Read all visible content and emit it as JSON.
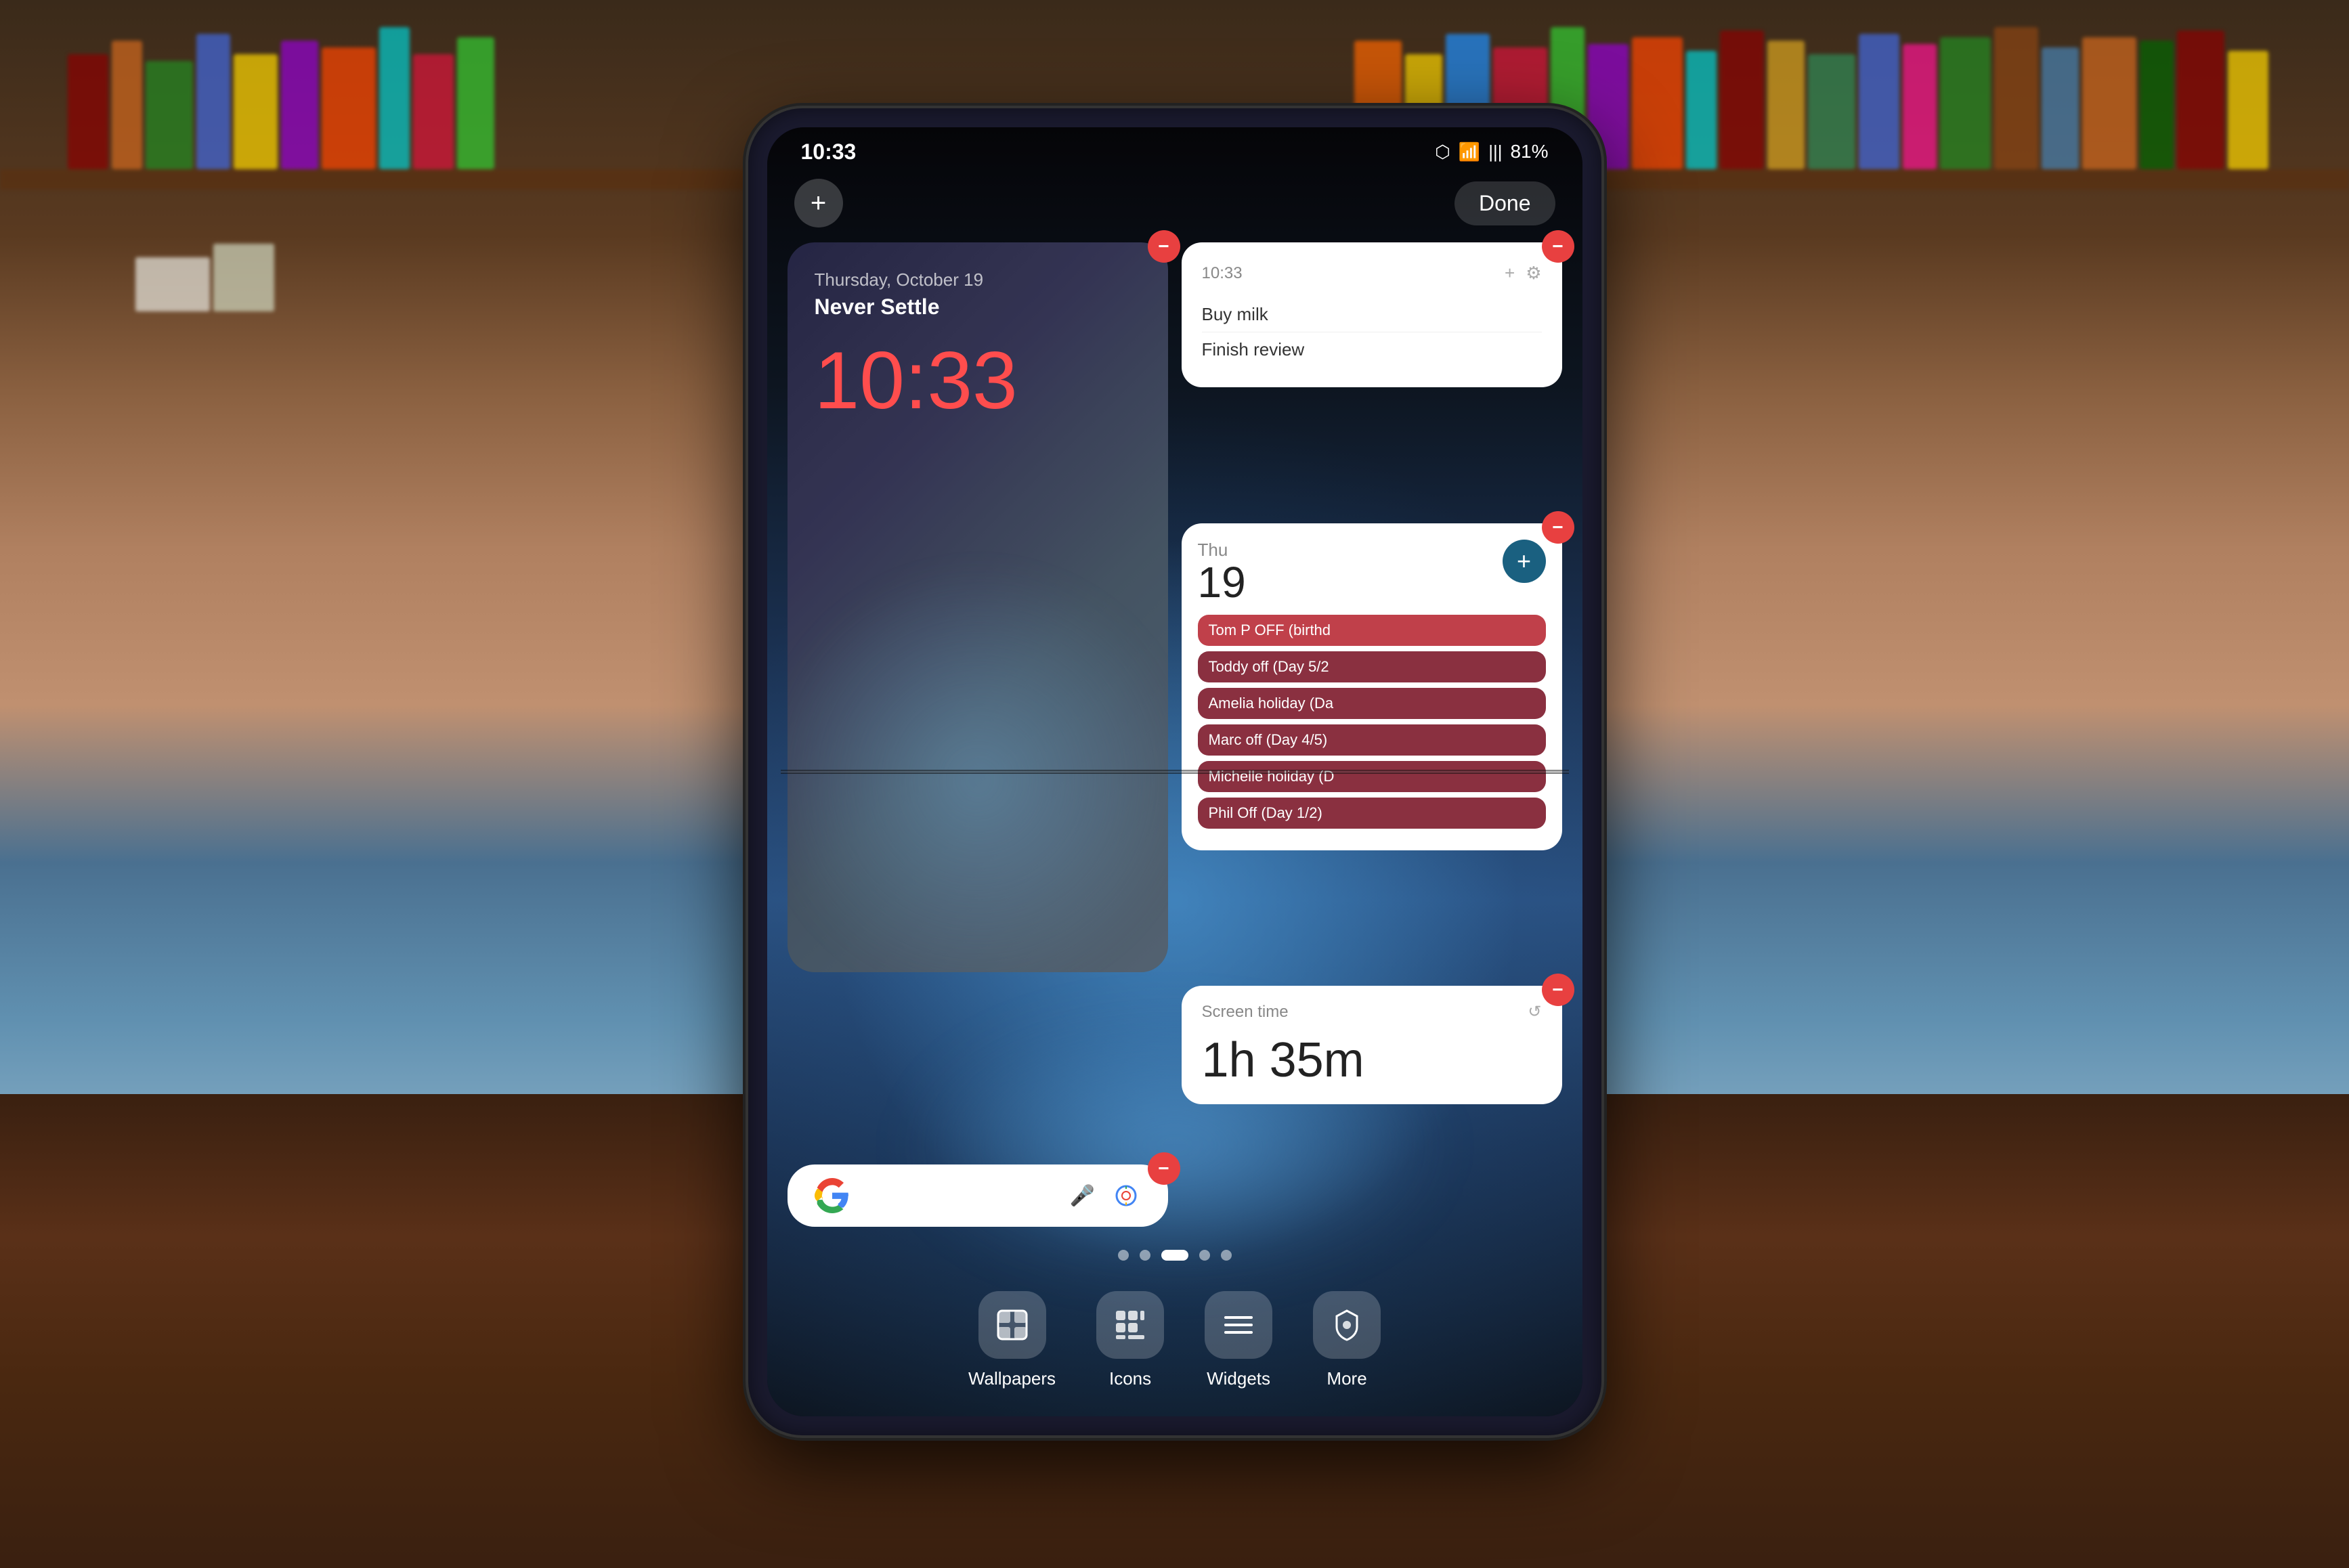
{
  "background": {
    "table_color": "#3a2010",
    "bookshelf_colors": [
      "#8B0000",
      "#FF6600",
      "#FFD700",
      "#228B22",
      "#00CED1",
      "#4169E1",
      "#9400D3",
      "#FF1493",
      "#FF4500",
      "#32CD32"
    ]
  },
  "status_bar": {
    "time": "10:33",
    "battery": "81%",
    "battery_icon": "🔋",
    "bluetooth_icon": "⬡",
    "wifi_icon": "📶",
    "signal_bars": "|||"
  },
  "toolbar": {
    "add_label": "+",
    "done_label": "Done"
  },
  "clock_widget": {
    "date": "Thursday, October 19",
    "subtitle": "Never Settle",
    "time": "10:33"
  },
  "notes_widget": {
    "title": "10:33",
    "note1": "Buy milk",
    "note2": "Finish review"
  },
  "calendar_widget": {
    "day": "Thu",
    "date": "19",
    "events": [
      {
        "text": "Tom P OFF (birthd",
        "color": "red"
      },
      {
        "text": "Toddy off (Day 5/2",
        "color": "maroon"
      },
      {
        "text": "Amelia holiday (Da",
        "color": "maroon"
      },
      {
        "text": "Marc off (Day 4/5)",
        "color": "maroon"
      },
      {
        "text": "Michelle holiday (D",
        "color": "maroon"
      },
      {
        "text": "Phil Off (Day 1/2)",
        "color": "maroon"
      }
    ]
  },
  "screentime_widget": {
    "label": "Screen time",
    "time": "1h 35m"
  },
  "search_widget": {
    "placeholder": ""
  },
  "page_dots": [
    {
      "active": false
    },
    {
      "active": false
    },
    {
      "active": true
    },
    {
      "active": false
    },
    {
      "active": false
    }
  ],
  "dock": {
    "items": [
      {
        "icon": "🖼",
        "label": "Wallpapers"
      },
      {
        "icon": "⊞",
        "label": "Icons"
      },
      {
        "icon": "☰",
        "label": "Widgets"
      },
      {
        "icon": "⚙",
        "label": "More"
      }
    ]
  }
}
